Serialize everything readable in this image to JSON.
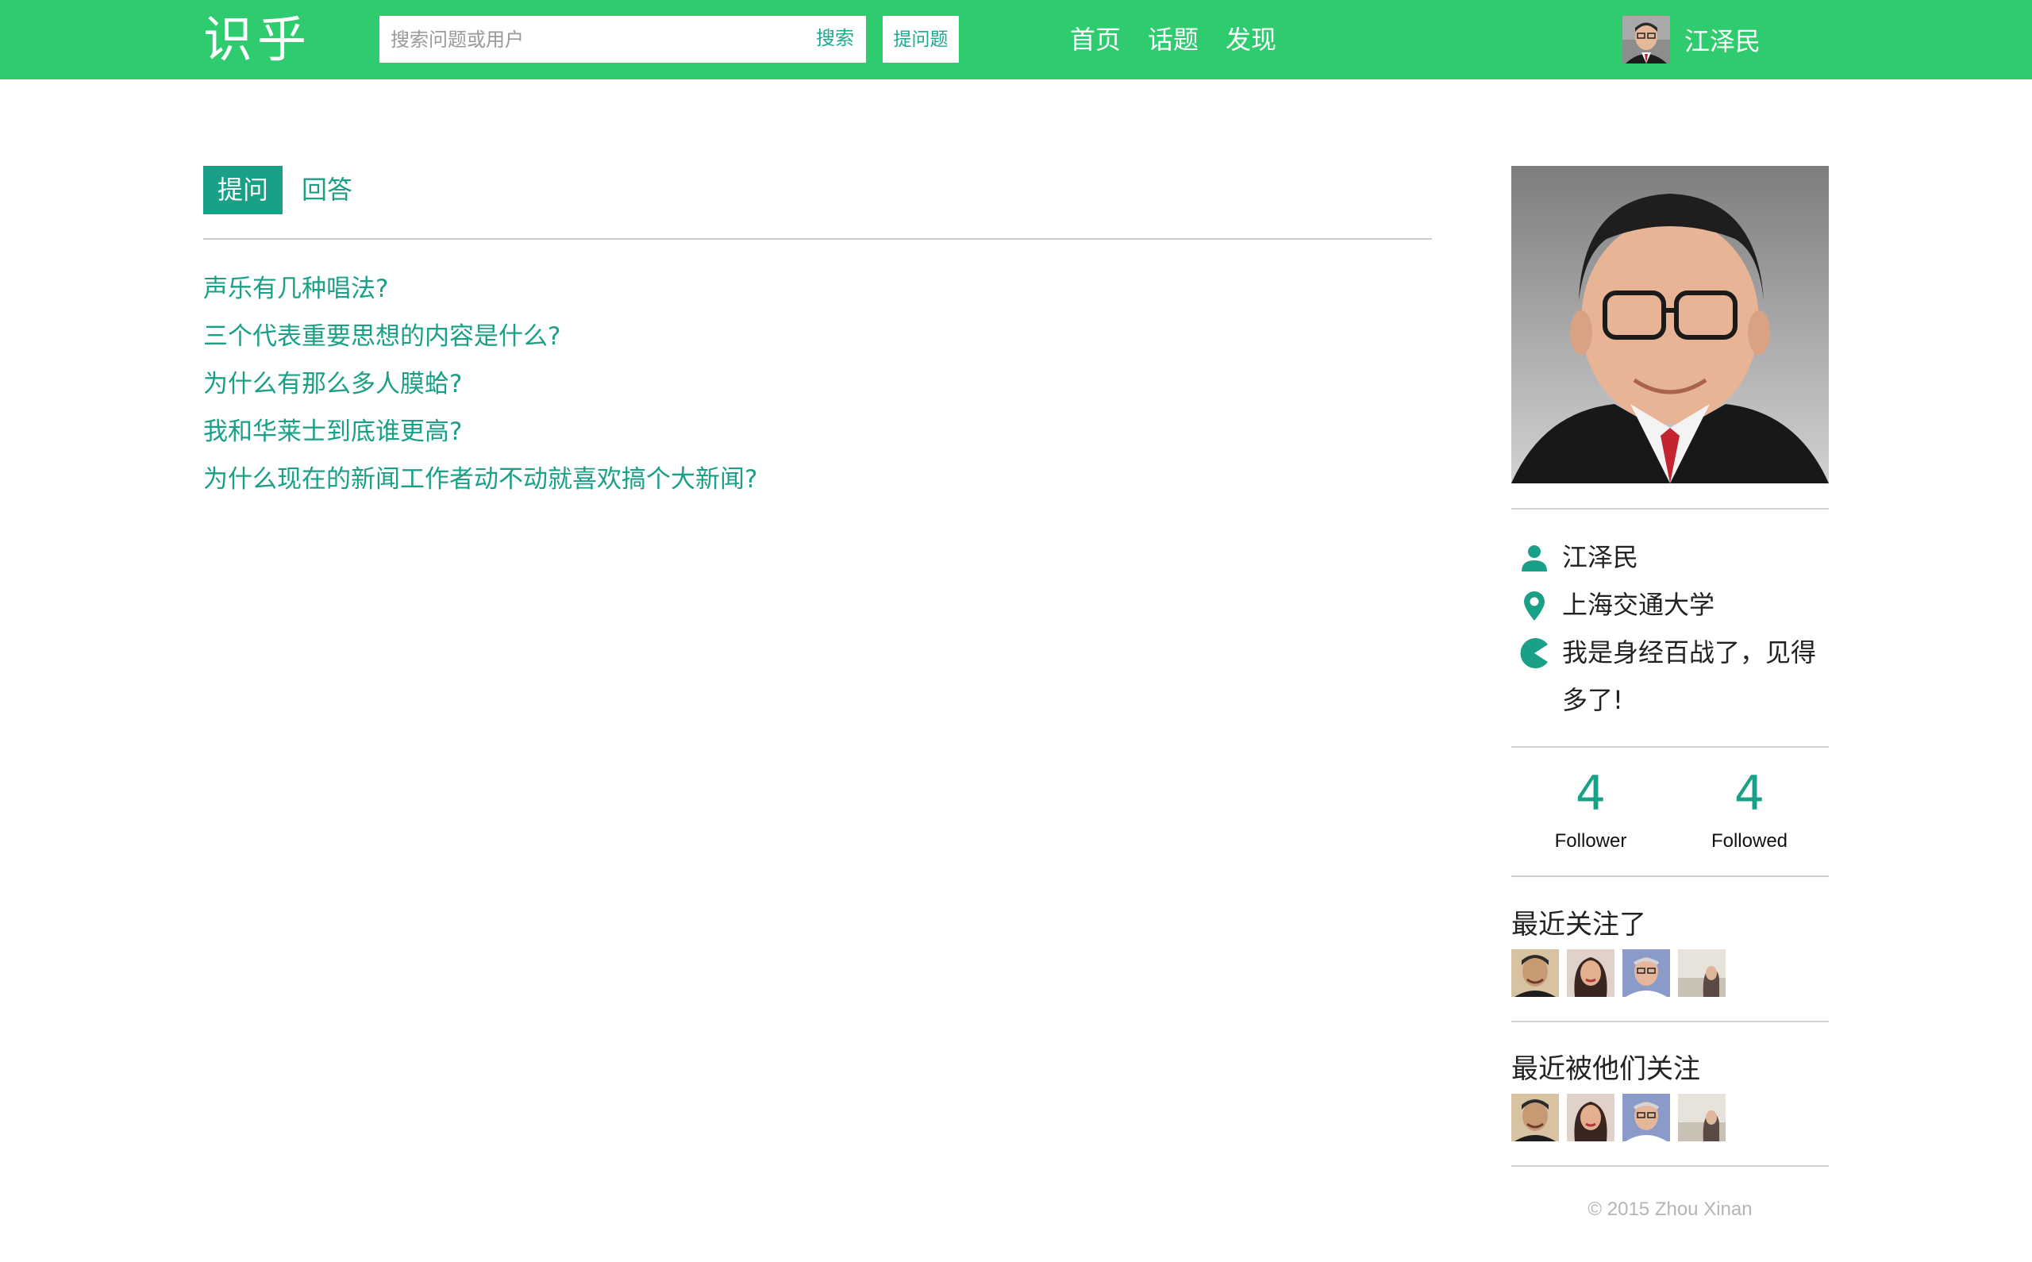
{
  "app": {
    "logo": "识乎"
  },
  "header": {
    "search_placeholder": "搜索问题或用户",
    "search_button": "搜索",
    "ask_button": "提问题",
    "nav": [
      {
        "label": "首页"
      },
      {
        "label": "话题"
      },
      {
        "label": "发现"
      }
    ],
    "user_name": "江泽民"
  },
  "tabs": {
    "active": "提问",
    "other": "回答"
  },
  "questions": [
    {
      "title": "声乐有几种唱法?"
    },
    {
      "title": "三个代表重要思想的内容是什么?"
    },
    {
      "title": "为什么有那么多人膜蛤?"
    },
    {
      "title": "我和华莱士到底谁更高?"
    },
    {
      "title": "为什么现在的新闻工作者动不动就喜欢搞个大新闻?"
    }
  ],
  "profile": {
    "name": "江泽民",
    "school": "上海交通大学",
    "bio": "我是身经百战了，见得多了!",
    "follower_count": "4",
    "follower_label": "Follower",
    "followed_count": "4",
    "followed_label": "Followed"
  },
  "recent_following": {
    "title": "最近关注了"
  },
  "recent_followers": {
    "title": "最近被他们关注"
  },
  "footer": {
    "text": "© 2015 Zhou Xinan"
  },
  "colors": {
    "topbar": "#2ecc6e",
    "accent": "#1aa086"
  },
  "icons": {
    "name": "person-icon",
    "school": "location-pin-icon",
    "bio": "pacman-icon"
  }
}
